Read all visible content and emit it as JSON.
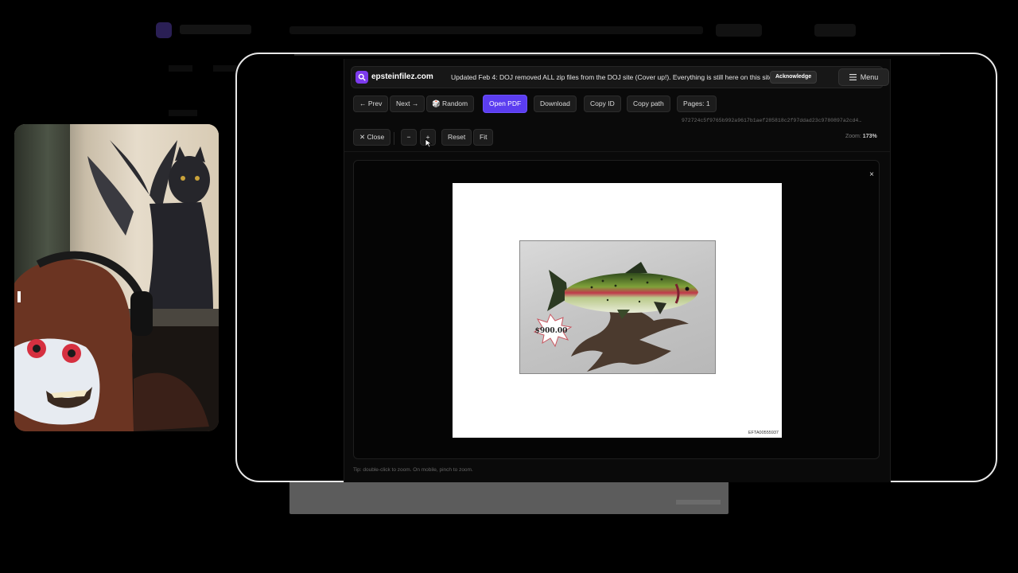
{
  "site": {
    "name": "epsteinfilez.com",
    "notice": "Updated Feb 4: DOJ removed ALL zip files from the DOJ site (Cover up!). Everything is still here on this site.",
    "acknowledge_label": "Acknowledge",
    "menu_label": "Menu"
  },
  "toolbar": {
    "prev_label": "← Prev",
    "next_label": "Next →",
    "random_label": "Random",
    "open_pdf_label": "Open PDF",
    "download_label": "Download",
    "copy_id_label": "Copy ID",
    "copy_path_label": "Copy path",
    "pages_label": "Pages: 1",
    "hash": "972724c5f9765b992a9617b1aef285818c2f97ddad23c9780897a2cd4…"
  },
  "viewer_controls": {
    "close_label": "✕ Close",
    "zoom_out_label": "−",
    "zoom_in_label": "+",
    "reset_label": "Reset",
    "fit_label": "Fit",
    "zoom_prefix": "Zoom:",
    "zoom_value": "173%"
  },
  "document": {
    "price_tag": "$900.00",
    "doc_id": "EFTA00555937"
  },
  "tip": "Tip: double-click to zoom. On mobile, pinch to zoom.",
  "colors": {
    "accent": "#5b3df0",
    "logo": "#7c3aed",
    "background": "#0a0a0a"
  },
  "icons": {
    "logo": "search-icon",
    "menu": "hamburger-icon",
    "random": "dice-icon",
    "viewer_close": "close-icon"
  }
}
